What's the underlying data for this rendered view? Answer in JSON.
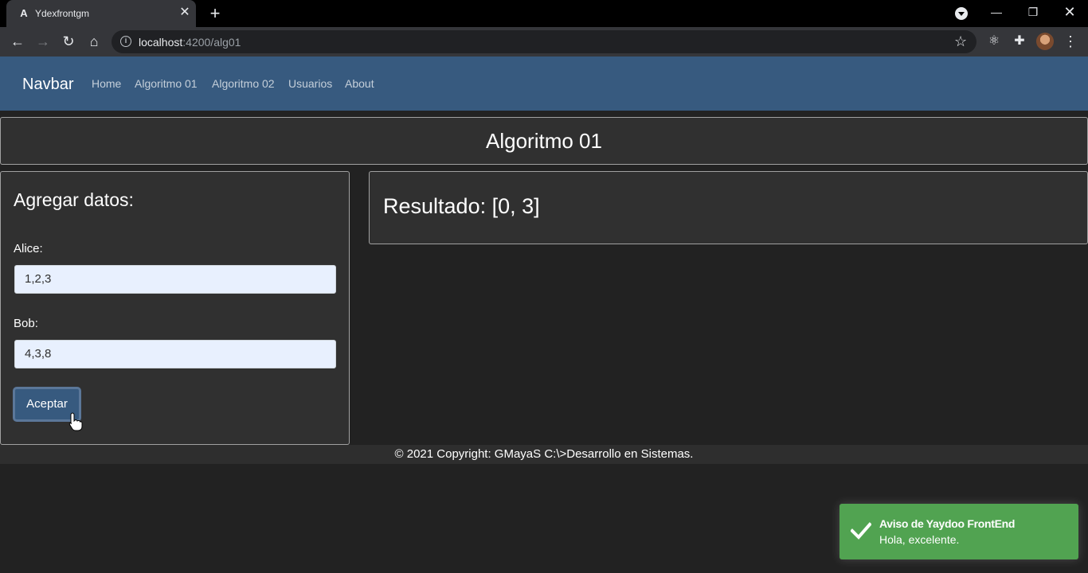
{
  "browser": {
    "tab_title": "Ydexfrontgm",
    "tab_favicon": "A",
    "url_host": "localhost",
    "url_path": ":4200/alg01",
    "icons": [
      "back-icon",
      "forward-icon",
      "reload-icon",
      "home-icon",
      "info-icon",
      "star-icon",
      "extension-icon",
      "puzzle-icon",
      "menu-icon"
    ]
  },
  "navbar": {
    "brand": "Navbar",
    "links": [
      "Home",
      "Algoritmo 01",
      "Algoritmo 02",
      "Usuarios",
      "About"
    ],
    "color": "#375a7f"
  },
  "page": {
    "title": "Algoritmo 01"
  },
  "form": {
    "title": "Agregar datos:",
    "alice_label": "Alice:",
    "alice_value": "1,2,3",
    "bob_label": "Bob:",
    "bob_value": "4,3,8",
    "submit_label": "Aceptar"
  },
  "result": {
    "text": "Resultado: [0, 3]"
  },
  "footer": {
    "text": "© 2021 Copyright: GMayaS C:\\>Desarrollo en Sistemas."
  },
  "toast": {
    "title": "Aviso de Yaydoo FrontEnd",
    "message": "Hola, excelente.",
    "color": "#51a351"
  }
}
